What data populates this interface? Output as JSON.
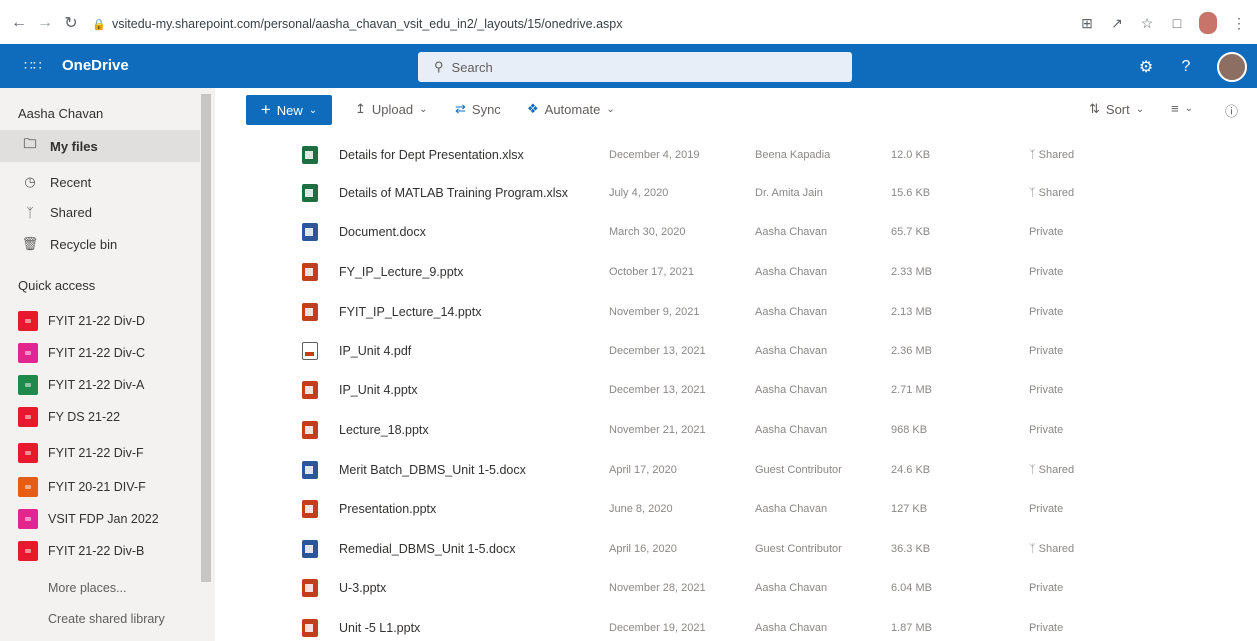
{
  "browser": {
    "url": "vsitedu-my.sharepoint.com/personal/aasha_chavan_vsit_edu_in2/_layouts/15/onedrive.aspx",
    "icons": [
      "back-icon",
      "forward-icon",
      "reload-icon",
      "lock-icon",
      "install-icon",
      "share-icon",
      "star-icon",
      "tab-icon",
      "profile-icon",
      "menu-icon"
    ]
  },
  "appbar": {
    "app_name": "OneDrive",
    "search_placeholder": "Search",
    "accent": "#0f6cbd"
  },
  "sidebar": {
    "user": "Aasha Chavan",
    "nav": [
      {
        "label": "My files",
        "icon": "folder-icon",
        "selected": true
      },
      {
        "label": "Recent",
        "icon": "clock-icon",
        "selected": false
      },
      {
        "label": "Shared",
        "icon": "people-icon",
        "selected": false
      },
      {
        "label": "Recycle bin",
        "icon": "recycle-bin-icon",
        "selected": false
      }
    ],
    "quick_access_title": "Quick access",
    "quick_access": [
      {
        "label": "FYIT 21-22 Div-D",
        "color": "#e8192c"
      },
      {
        "label": "FYIT 21-22 Div-C",
        "color": "#e3258f"
      },
      {
        "label": "FYIT 21-22 Div-A",
        "color": "#1f8a4c"
      },
      {
        "label": "FY DS 21-22",
        "color": "#e8192c"
      },
      {
        "label": "FYIT 21-22 Div-F",
        "color": "#e8192c"
      },
      {
        "label": "FYIT 20-21 DIV-F",
        "color": "#e65d16"
      },
      {
        "label": "VSIT FDP Jan 2022",
        "color": "#e3258f"
      },
      {
        "label": "FYIT 21-22 Div-B",
        "color": "#e8192c"
      }
    ],
    "more_places": "More places...",
    "create_library": "Create shared library"
  },
  "toolbar": {
    "new_label": "New",
    "upload_label": "Upload",
    "sync_label": "Sync",
    "automate_label": "Automate",
    "sort_label": "Sort"
  },
  "files": [
    {
      "name": "Details for Dept Presentation.xlsx",
      "type": "xlsx",
      "modified": "December 4, 2019",
      "modified_by": "Beena Kapadia",
      "size": "12.0 KB",
      "sharing": "Shared"
    },
    {
      "name": "Details of MATLAB Training Program.xlsx",
      "type": "xlsx",
      "modified": "July 4, 2020",
      "modified_by": "Dr. Amita Jain",
      "size": "15.6 KB",
      "sharing": "Shared"
    },
    {
      "name": "Document.docx",
      "type": "docx",
      "modified": "March 30, 2020",
      "modified_by": "Aasha Chavan",
      "size": "65.7 KB",
      "sharing": "Private"
    },
    {
      "name": "FY_IP_Lecture_9.pptx",
      "type": "pptx",
      "modified": "October 17, 2021",
      "modified_by": "Aasha Chavan",
      "size": "2.33 MB",
      "sharing": "Private"
    },
    {
      "name": "FYIT_IP_Lecture_14.pptx",
      "type": "pptx",
      "modified": "November 9, 2021",
      "modified_by": "Aasha Chavan",
      "size": "2.13 MB",
      "sharing": "Private"
    },
    {
      "name": "IP_Unit 4.pdf",
      "type": "pdf",
      "modified": "December 13, 2021",
      "modified_by": "Aasha Chavan",
      "size": "2.36 MB",
      "sharing": "Private"
    },
    {
      "name": "IP_Unit 4.pptx",
      "type": "pptx",
      "modified": "December 13, 2021",
      "modified_by": "Aasha Chavan",
      "size": "2.71 MB",
      "sharing": "Private"
    },
    {
      "name": "Lecture_18.pptx",
      "type": "pptx",
      "modified": "November 21, 2021",
      "modified_by": "Aasha Chavan",
      "size": "968 KB",
      "sharing": "Private"
    },
    {
      "name": "Merit Batch_DBMS_Unit 1-5.docx",
      "type": "docx",
      "modified": "April 17, 2020",
      "modified_by": "Guest Contributor",
      "size": "24.6 KB",
      "sharing": "Shared"
    },
    {
      "name": "Presentation.pptx",
      "type": "pptx",
      "modified": "June 8, 2020",
      "modified_by": "Aasha Chavan",
      "size": "127 KB",
      "sharing": "Private"
    },
    {
      "name": "Remedial_DBMS_Unit 1-5.docx",
      "type": "docx",
      "modified": "April 16, 2020",
      "modified_by": "Guest Contributor",
      "size": "36.3 KB",
      "sharing": "Shared"
    },
    {
      "name": "U-3.pptx",
      "type": "pptx",
      "modified": "November 28, 2021",
      "modified_by": "Aasha Chavan",
      "size": "6.04 MB",
      "sharing": "Private"
    },
    {
      "name": "Unit -5 L1.pptx",
      "type": "pptx",
      "modified": "December 19, 2021",
      "modified_by": "Aasha Chavan",
      "size": "1.87 MB",
      "sharing": "Private"
    }
  ]
}
